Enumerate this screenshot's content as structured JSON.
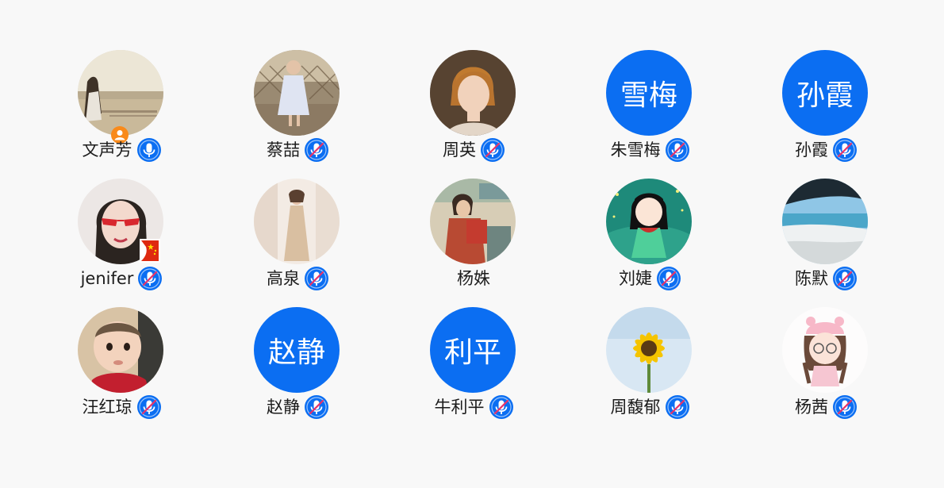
{
  "participants": [
    {
      "name": "文声芳",
      "avatar": "photo-woman-seaside-avatar",
      "mic": "on",
      "badge": "host-icon"
    },
    {
      "name": "蔡喆",
      "avatar": "photo-child-fence-avatar",
      "mic": "off"
    },
    {
      "name": "周英",
      "avatar": "photo-woman-portrait-avatar",
      "mic": "off"
    },
    {
      "name": "朱雪梅",
      "avatar_text": "雪梅",
      "mic": "off"
    },
    {
      "name": "孙霞",
      "avatar_text": "孙霞",
      "mic": "off"
    },
    {
      "name": "jenifer",
      "avatar": "photo-woman-red-glasses-avatar",
      "mic": "off",
      "badge": "china-flag-icon"
    },
    {
      "name": "高泉",
      "avatar": "photo-woman-dress-avatar",
      "mic": "off"
    },
    {
      "name": "杨姝",
      "avatar": "photo-vintage-woman-reading-avatar",
      "mic": "none"
    },
    {
      "name": "刘婕",
      "avatar": "cartoon-girl-avatar",
      "mic": "off"
    },
    {
      "name": "陈默",
      "avatar": "photo-beach-avatar",
      "mic": "off"
    },
    {
      "name": "汪红琼",
      "avatar": "photo-baby-avatar",
      "mic": "off"
    },
    {
      "name": "赵静",
      "avatar_text": "赵静",
      "mic": "off"
    },
    {
      "name": "牛利平",
      "avatar_text": "利平",
      "mic": "off"
    },
    {
      "name": "周馥郁",
      "avatar": "photo-sunflower-avatar",
      "mic": "off"
    },
    {
      "name": "杨茜",
      "avatar": "cartoon-pink-hat-girl-avatar",
      "mic": "off"
    }
  ],
  "colors": {
    "accent": "#0b6ef2",
    "mic_off_slash": "#e8336a",
    "host_badge": "#f98a1a",
    "background": "#f8f8f8"
  }
}
